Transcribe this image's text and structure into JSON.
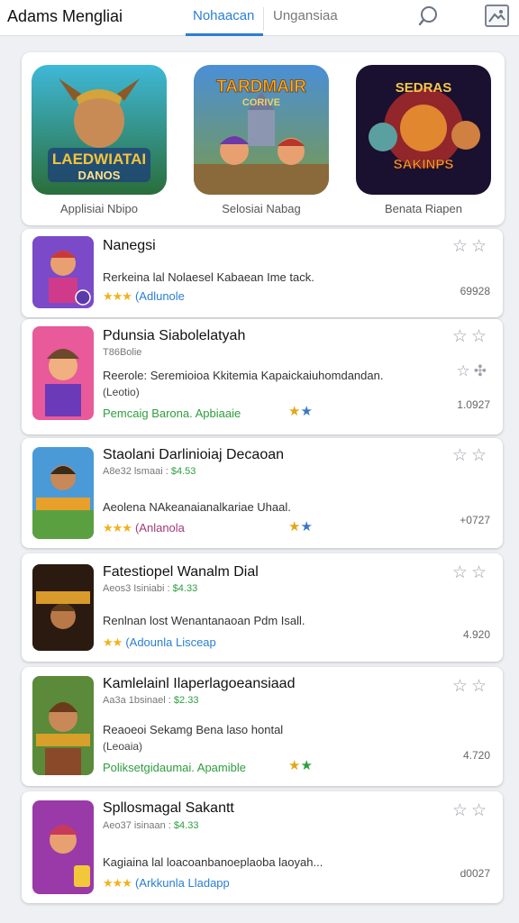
{
  "header": {
    "app_title": "Adams Mengliai",
    "tabs": [
      {
        "label": "Nohaacan"
      },
      {
        "label": "Ungansiaa"
      }
    ],
    "search_icon": "search-icon",
    "image_icon": "image-icon"
  },
  "featured": {
    "items": [
      {
        "art_title": "LAEDWIATAI",
        "art_sub": "DANOS",
        "label": "Applisiai Nbipo"
      },
      {
        "art_title": "TARDMAIR",
        "art_sub": "CORIVE",
        "label": "Selosiai Nabag"
      },
      {
        "art_title": "SEDRAS",
        "art_sub": "SAKINPS",
        "label": "Benata Riapen"
      }
    ]
  },
  "list": [
    {
      "title": "Nanegsi",
      "subtitle": "",
      "price": "",
      "description": "Rerkeina lal Nolaesel Kabaean Ime tack.",
      "note": "",
      "stars": "★★★",
      "developer": "(Adlunole",
      "count": "69928"
    },
    {
      "title": "Pdunsia Siabolelatyah",
      "subtitle": "T86Bolie",
      "price": "",
      "description": "Reerole: Seremioioa Kkitemia Kapaickaiuhomdandan.",
      "note": "(Leotio)",
      "stars": "",
      "developer": "Pemcaig Barona. Apbiaaie",
      "count": "1.0927"
    },
    {
      "title": "Staolani Darlinioiaj Decaoan",
      "subtitle": "A8e32 lsmaai :",
      "price": "$4.53",
      "description": "Aeolena NAkeanaianalkariae Uhaal.",
      "note": "",
      "stars": "★★★",
      "developer": "(Anlanola",
      "count": "+0727"
    },
    {
      "title": "Fatestiopel Wanalm Dial",
      "subtitle": "Aeos3 Isiniabi :",
      "price": "$4.33",
      "description": "Renlnan lost Wenantanaoan Pdm Isall.",
      "note": "",
      "stars": "★★",
      "developer": "(Adounla Lisceap",
      "count": "4.920"
    },
    {
      "title": "Kamlelainl Ilaperlagoeansiaad",
      "subtitle": "Aa3a 1bsinael :",
      "price": "$2.33",
      "description": "Reaoeoi Sekamg Bena laso hontal",
      "note": "(Leoaia)",
      "stars": "",
      "developer": "Poliksetgidaumai. Apamible",
      "count": "4.720"
    },
    {
      "title": "Spllosmagal Sakantt",
      "subtitle": "Aeo37 isinaan :",
      "price": "$4.33",
      "description": "Kagiaina lal loacoanbanoeplaoba laoyah...",
      "note": "",
      "stars": "★★★",
      "developer": "(Arkkunla Lladapp",
      "count": "d0027"
    }
  ]
}
